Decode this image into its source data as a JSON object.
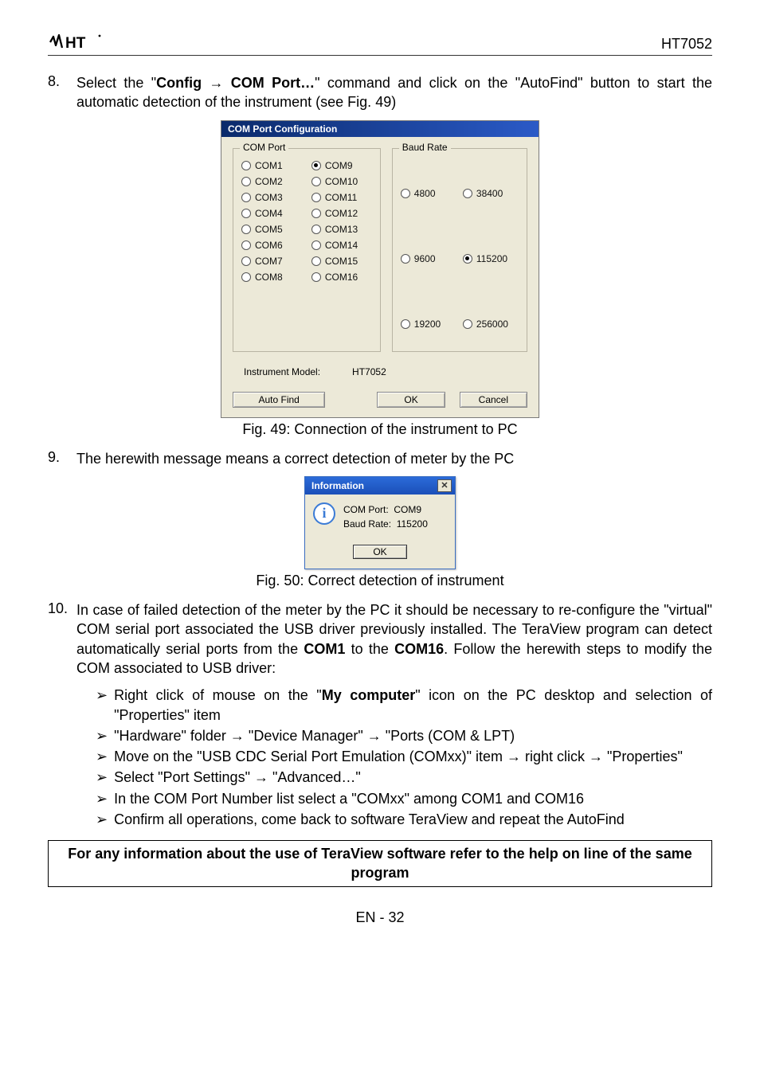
{
  "header": {
    "doc_title": "HT7052"
  },
  "item8": {
    "num": "8.",
    "text_before": "Select the \"",
    "bold1": "Config ",
    "arrow": "→",
    "bold2": " COM Port…",
    "text_after": "\" command and click on the \"AutoFind\" button to start the automatic detection of the instrument (see Fig. 49)"
  },
  "dialog1": {
    "title": "COM Port  Configuration",
    "com_legend": "COM Port",
    "baud_legend": "Baud Rate",
    "com_ports": [
      "COM1",
      "COM9",
      "COM2",
      "COM10",
      "COM3",
      "COM11",
      "COM4",
      "COM12",
      "COM5",
      "COM13",
      "COM6",
      "COM14",
      "COM7",
      "COM15",
      "COM8",
      "COM16"
    ],
    "com_selected": "COM9",
    "baud_rates": [
      "4800",
      "38400",
      "9600",
      "115200",
      "19200",
      "256000"
    ],
    "baud_selected": "115200",
    "instr_label": "Instrument Model:",
    "instr_value": "HT7052",
    "btn_autofind": "Auto Find",
    "btn_ok": "OK",
    "btn_cancel": "Cancel"
  },
  "fig49": "Fig. 49: Connection of the instrument to PC",
  "item9": {
    "num": "9.",
    "text": "The herewith message means a correct detection of meter by the PC"
  },
  "dialog2": {
    "title": "Information",
    "line1_label": "COM Port:",
    "line1_value": "COM9",
    "line2_label": "Baud Rate:",
    "line2_value": "115200",
    "ok": "OK"
  },
  "fig50": "Fig. 50: Correct detection of instrument",
  "item10": {
    "num": "10.",
    "text_parts": [
      "In case of failed detection of the meter by the PC it should be necessary to re-configure the \"virtual\" COM serial port associated the USB driver previously installed. The TeraView program can detect automatically serial ports from the ",
      " to the ",
      ". Follow the herewith steps to modify the COM associated to USB driver:"
    ],
    "bold_com1": "COM1",
    "bold_com16": "COM16"
  },
  "bullets": [
    {
      "pre": "Right click of mouse on the \"",
      "bold": "My computer",
      "post": "\" icon on the PC desktop and selection of \"Properties\" item"
    },
    {
      "plain": "\"Hardware\" folder → \"Device Manager\" → \"Ports (COM & LPT)"
    },
    {
      "plain": "Move on the \"USB CDC Serial Port Emulation (COMxx)\" item → right click → \"Properties\""
    },
    {
      "plain": "Select \"Port Settings\" → \"Advanced…\""
    },
    {
      "plain": "In the COM Port Number list select a \"COMxx\" among COM1 and COM16"
    },
    {
      "plain": "Confirm all operations, come back to software TeraView and repeat the AutoFind"
    }
  ],
  "note": "For any information about the use of TeraView software refer to the help on line of the same program",
  "footer": "EN - 32"
}
